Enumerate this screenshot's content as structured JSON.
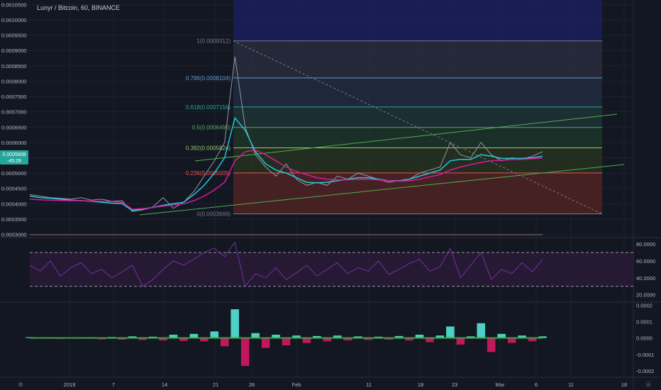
{
  "title": "Lunyr / Bitcoin, 60, BINANCE",
  "colors": {
    "background": "#131722",
    "grid": "#1e2230",
    "price": "#9598a1",
    "ema_fast": "#26c6da",
    "ema_slow": "#d81b9c",
    "trendline": "#4caf50",
    "rsi": "#7b2f9e",
    "osc_pos": "#4dd0c6",
    "osc_neg": "#c2185b",
    "osc_sig": "#43a047",
    "price_tag": "#26a69a"
  },
  "price_tag": {
    "value": "0.0005608",
    "sub": "-45:29"
  },
  "chart_data": [
    {
      "type": "line",
      "panel": "price",
      "symbol": "Lunyr / Bitcoin",
      "interval": "60",
      "exchange": "BINANCE",
      "x_ticks": [
        "2019",
        "7",
        "14",
        "21",
        "26",
        "Feb",
        "11",
        "18",
        "23",
        "Mar",
        "6",
        "11",
        "18"
      ],
      "y_ticks": [
        "0.0010500",
        "0.0010000",
        "0.0009500",
        "0.0009000",
        "0.0008500",
        "0.0008000",
        "0.0007500",
        "0.0007000",
        "0.0006500",
        "0.0006000",
        "0.0005500",
        "0.0005000",
        "0.0004500",
        "0.0004000",
        "0.0003500",
        "0.0003000"
      ],
      "ylim": [
        0.0002944,
        0.0010554
      ],
      "series": [
        {
          "role": "close",
          "values": [
            0.00043,
            0.000425,
            0.00042,
            0.000418,
            0.000415,
            0.00042,
            0.000412,
            0.000415,
            0.000408,
            0.00041,
            0.000375,
            0.00038,
            0.00039,
            0.00042,
            0.000385,
            0.000405,
            0.00044,
            0.00049,
            0.00054,
            0.0006,
            0.00088,
            0.00065,
            0.00056,
            0.00052,
            0.00049,
            0.00053,
            0.00048,
            0.00046,
            0.00047,
            0.00046,
            0.00049,
            0.00048,
            0.0005,
            0.00049,
            0.00048,
            0.00047,
            0.000475,
            0.00048,
            0.0005,
            0.00051,
            0.00052,
            0.0006,
            0.00056,
            0.00055,
            0.0006,
            0.00056,
            0.00054,
            0.00055,
            0.000545,
            0.000555,
            0.00057
          ]
        },
        {
          "role": "ema_fast",
          "values": [
            0.000425,
            0.00042,
            0.000418,
            0.000415,
            0.000412,
            0.00041,
            0.000408,
            0.000405,
            0.000402,
            0.0004,
            0.000378,
            0.000382,
            0.000388,
            0.000395,
            0.0004,
            0.000405,
            0.00043,
            0.00046,
            0.0005,
            0.00055,
            0.00068,
            0.00064,
            0.00057,
            0.00053,
            0.00051,
            0.0005,
            0.000485,
            0.00047,
            0.000468,
            0.00047,
            0.000475,
            0.00048,
            0.000485,
            0.000485,
            0.00048,
            0.000475,
            0.000475,
            0.00048,
            0.00049,
            0.0005,
            0.00051,
            0.00054,
            0.000545,
            0.000545,
            0.00056,
            0.000555,
            0.000548,
            0.000548,
            0.000548,
            0.00055,
            0.000555
          ]
        },
        {
          "role": "ema_slow",
          "values": [
            0.000415,
            0.000413,
            0.000412,
            0.000411,
            0.00041,
            0.00041,
            0.000409,
            0.000408,
            0.000407,
            0.000405,
            0.000382,
            0.000384,
            0.000388,
            0.000392,
            0.000396,
            0.0004,
            0.00041,
            0.000425,
            0.000445,
            0.00047,
            0.00054,
            0.00057,
            0.000575,
            0.00056,
            0.00054,
            0.00052,
            0.000505,
            0.000495,
            0.000485,
            0.00048,
            0.000478,
            0.000478,
            0.00048,
            0.00048,
            0.000478,
            0.000475,
            0.000474,
            0.000475,
            0.00048,
            0.000488,
            0.000495,
            0.00051,
            0.00052,
            0.000528,
            0.000535,
            0.00054,
            0.000542,
            0.000544,
            0.000545,
            0.000547,
            0.000549
          ]
        }
      ],
      "fib_levels": [
        {
          "label": "1(0.0009312)",
          "value": 0.0009312,
          "color": "#787b86"
        },
        {
          "label": "0.786(0.0008104)",
          "value": 0.0008104,
          "color": "#5f9ad4"
        },
        {
          "label": "0.618(0.0007156)",
          "value": 0.0007156,
          "color": "#26a69a"
        },
        {
          "label": "0.5(0.0006490)",
          "value": 0.000649,
          "color": "#4caf50"
        },
        {
          "label": "0.382(0.0005824)",
          "value": 0.0005824,
          "color": "#9ccc65"
        },
        {
          "label": "0.236(0.0005005)",
          "value": 0.0005005,
          "color": "#ef5350"
        },
        {
          "label": "0(0.0003669)",
          "value": 0.0003669,
          "color": "#787b86"
        }
      ]
    },
    {
      "type": "line",
      "panel": "rsi",
      "y_ticks": [
        "80.0000",
        "60.0000",
        "40.0000",
        "20.0000"
      ],
      "ylim": [
        13,
        86
      ],
      "bands": [
        70,
        30
      ],
      "values": [
        55,
        48,
        60,
        42,
        52,
        58,
        45,
        50,
        40,
        47,
        55,
        30,
        38,
        50,
        60,
        55,
        62,
        70,
        75,
        65,
        82,
        30,
        45,
        40,
        52,
        38,
        46,
        55,
        42,
        50,
        58,
        45,
        52,
        48,
        60,
        44,
        50,
        57,
        62,
        48,
        53,
        75,
        40,
        55,
        70,
        38,
        50,
        45,
        58,
        47,
        62
      ]
    },
    {
      "type": "area",
      "panel": "oscillator",
      "y_ticks": [
        "0.0002",
        "0.0001",
        "0.0000",
        "-0.0001",
        "-0.0002"
      ],
      "ylim": [
        -0.00023,
        0.00021
      ],
      "values": [
        5e-06,
        -3e-06,
        4e-06,
        -5e-06,
        3e-06,
        -4e-06,
        5e-06,
        -8e-06,
        6e-06,
        -1e-05,
        1e-05,
        -1.2e-05,
        8e-06,
        -1.5e-05,
        2e-05,
        -1.8e-05,
        2.5e-05,
        -2e-05,
        4e-05,
        -5e-05,
        0.000175,
        -0.00017,
        3e-05,
        -6e-05,
        2e-05,
        -4.5e-05,
        1.5e-05,
        -3e-05,
        1.2e-05,
        -2e-05,
        1.5e-05,
        -1.5e-05,
        1e-05,
        -1.2e-05,
        8e-06,
        -1e-05,
        1.2e-05,
        -1.5e-05,
        2e-05,
        -2.5e-05,
        1.5e-05,
        7e-05,
        -4e-05,
        1e-05,
        9e-05,
        -8.5e-05,
        2.5e-05,
        -3e-05,
        1.5e-05,
        -2e-05,
        1e-05
      ]
    }
  ]
}
